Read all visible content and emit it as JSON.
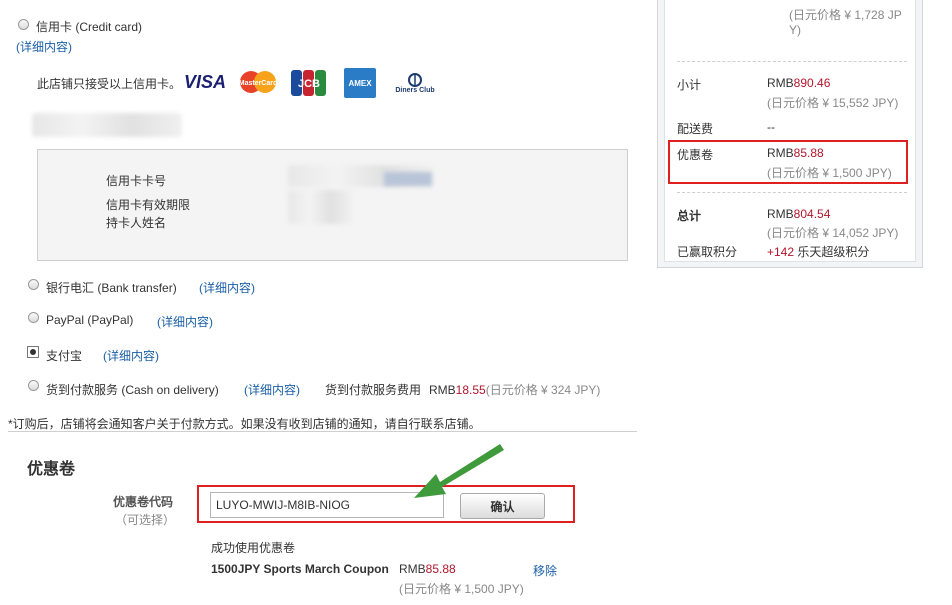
{
  "payment": {
    "credit_card": {
      "label": "信用卡 (Credit card)",
      "details_link": "(详细内容)",
      "accepts_text": "此店铺只接受以上信用卡。",
      "logos": [
        {
          "name": "visa-logo",
          "text": "VISA",
          "color": "#1a1f71"
        },
        {
          "name": "mastercard-logo",
          "text": "MasterCard",
          "color": "#e8432a"
        },
        {
          "name": "jcb-logo",
          "text": "JCB",
          "color": "#1d4b9c"
        },
        {
          "name": "amex-logo",
          "text": "AMEX",
          "color": "#2a7cc7"
        },
        {
          "name": "diners-club-logo",
          "text": "Diners Club",
          "color": "#1d3a6e"
        }
      ],
      "fields": {
        "card_number": "信用卡卡号",
        "expiry": "信用卡有效期限",
        "holder": "持卡人姓名"
      }
    },
    "bank_transfer": {
      "label": "银行电汇 (Bank transfer)",
      "details_link": "(详细内容)"
    },
    "paypal": {
      "label": "PayPal (PayPal)",
      "details_link": "(详细内容)"
    },
    "alipay": {
      "label": "支付宝",
      "details_link": "(详细内容)"
    },
    "cod": {
      "label": "货到付款服务 (Cash on delivery)",
      "details_link": "(详细内容)",
      "fee_label": "货到付款服务费用",
      "fee_prefix": "RMB",
      "fee_value": "18.55",
      "fee_jpy": "(日元价格 ¥ 324 JPY)"
    },
    "notice": "*订购后，店铺将会通知客户关于付款方式。如果没有收到店铺的通知，请自行联系店铺。"
  },
  "coupon": {
    "section_title": "优惠卷",
    "code_label": "优惠卷代码",
    "optional": "（可选择）",
    "code_value": "LUYO-MWIJ-M8IB-NIOG",
    "confirm_button": "确认",
    "success_text": "成功使用优惠卷",
    "applied_name": "1500JPY Sports March Coupon",
    "applied_prefix": "RMB",
    "applied_value": "85.88",
    "applied_jpy": "(日元价格 ¥ 1,500 JPY)",
    "remove_link": "移除"
  },
  "summary": {
    "top_jpy_line1": "(日元价格 ¥ 1,728 JP",
    "top_jpy_line2": "Y)",
    "subtotal_label": "小计",
    "subtotal_prefix": "RMB",
    "subtotal_value": "890.46",
    "subtotal_jpy": "(日元价格 ¥ 15,552 JPY)",
    "shipping_label": "配送费",
    "shipping_value": "--",
    "coupon_label": "优惠卷",
    "coupon_prefix": "RMB",
    "coupon_value": "85.88",
    "coupon_jpy": "(日元价格 ¥ 1,500 JPY)",
    "total_label": "总计",
    "total_prefix": "RMB",
    "total_value": "804.54",
    "total_jpy": "(日元价格 ¥ 14,052 JPY)",
    "points_label": "已赢取积分",
    "points_value": "+142",
    "points_suffix": " 乐天超级积分"
  },
  "colors": {
    "price_red": "#b3152b",
    "link_blue": "#1a5fa6",
    "highlight_red": "#e02020",
    "arrow_green": "#3f9a3c"
  }
}
